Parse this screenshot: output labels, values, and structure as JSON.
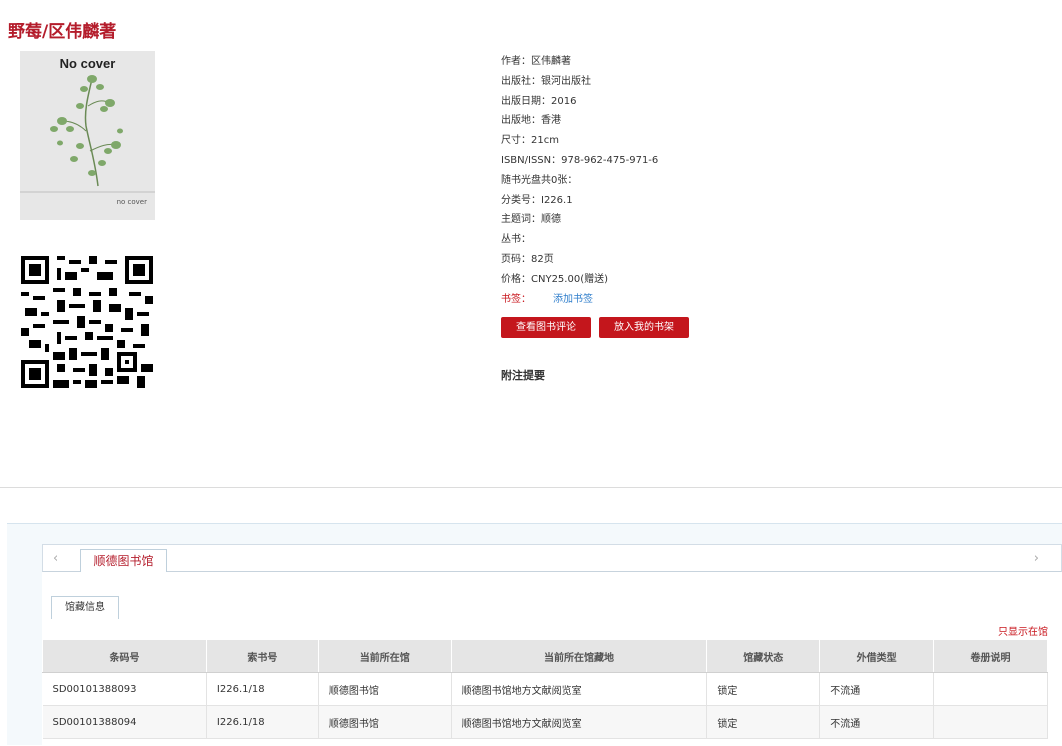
{
  "book": {
    "title": "野莓",
    "separator": "/",
    "author": "区伟麟著"
  },
  "cover": {
    "label": "No cover",
    "small_label": "no cover"
  },
  "info": {
    "author": "作者：区伟麟著",
    "publisher": "出版社：银河出版社",
    "pub_date": "出版日期：2016",
    "pub_place": "出版地：香港",
    "size": "尺寸：21cm",
    "isbn": "ISBN/ISSN：978-962-475-971-6",
    "cd": "随书光盘共0张：",
    "class_no": "分类号：I226.1",
    "subject": "主题词：顺德",
    "series": "丛书：",
    "pages": "页码：82页",
    "price": "价格：CNY25.00(赠送)",
    "tag_label": "书签：",
    "tag_link": "添加书签"
  },
  "buttons": {
    "view_reviews": "查看图书评论",
    "add_shelf": "放入我的书架"
  },
  "notes_heading": "附注提要",
  "library": {
    "nav_left": "‹",
    "nav_right": "›",
    "tab": "顺德图书馆",
    "subtab": "馆藏信息",
    "only_show": "只显示在馆",
    "columns": [
      "条码号",
      "索书号",
      "当前所在馆",
      "当前所在馆藏地",
      "馆藏状态",
      "外借类型",
      "卷册说明"
    ],
    "rows": [
      [
        "SD00101388093",
        "I226.1/18",
        "顺德图书馆",
        "顺德图书馆地方文献阅览室",
        "锁定",
        "不流通",
        ""
      ],
      [
        "SD00101388094",
        "I226.1/18",
        "顺德图书馆",
        "顺德图书馆地方文献阅览室",
        "锁定",
        "不流通",
        ""
      ]
    ]
  },
  "colors": {
    "accent": "#c4161c",
    "title": "#b41c2b",
    "link": "#2f7ecb"
  }
}
